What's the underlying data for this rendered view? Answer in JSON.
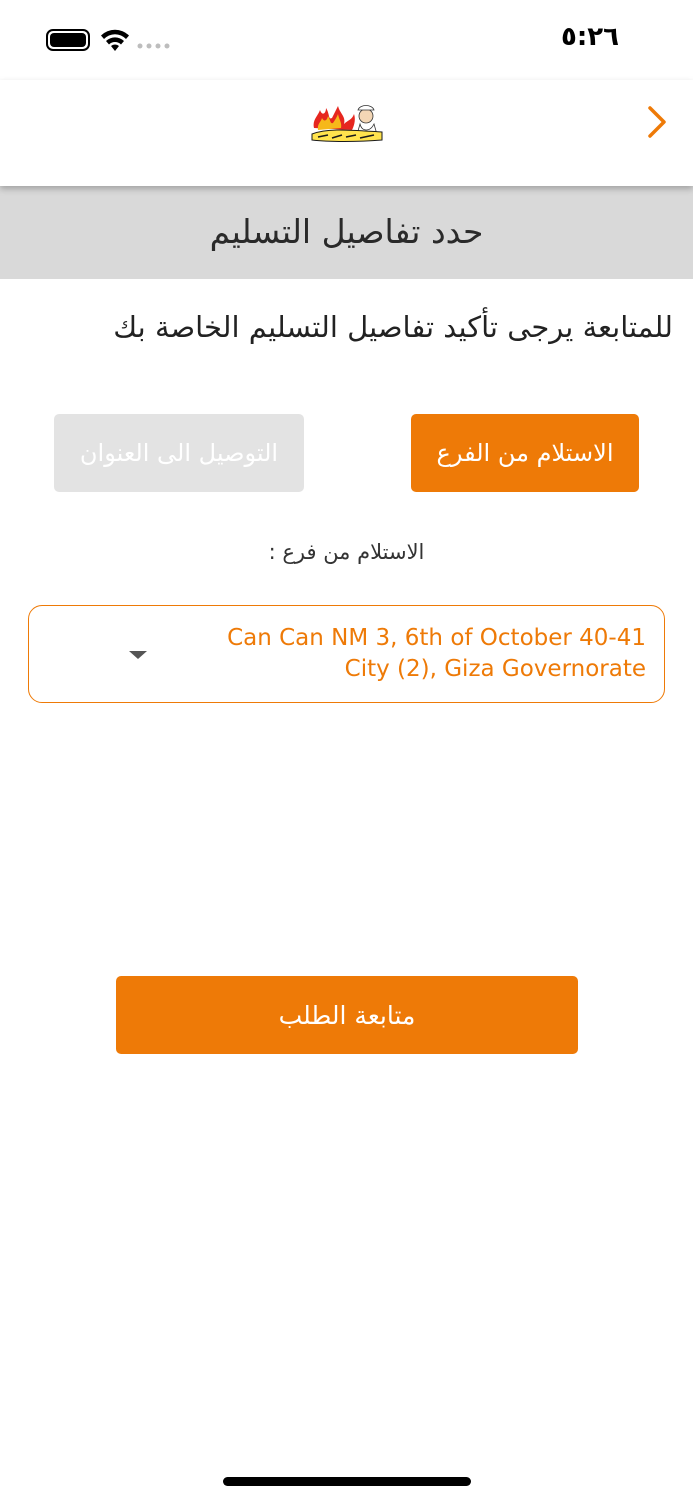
{
  "status_bar": {
    "time": "٥:٢٦",
    "icons": [
      "battery-icon",
      "wifi-icon",
      "signal-icon"
    ]
  },
  "nav": {
    "back_icon": "chevron-right-icon",
    "logo_icon": "restaurant-logo-icon"
  },
  "header": {
    "title": "حدد تفاصيل التسليم"
  },
  "instructions": "للمتابعة يرجى تأكيد تفاصيل التسليم الخاصة بك",
  "delivery_options": {
    "pickup_label": "الاستلام من الفرع",
    "delivery_label": "التوصيل الى العنوان",
    "selected": "pickup"
  },
  "branch": {
    "label": "الاستلام من فرع :",
    "selected_value": "Can Can NM 3, 6th of October 40-41 City (2), Giza Governorate",
    "dropdown_icon": "caret-down-icon"
  },
  "continue_button": {
    "label": "متابعة الطلب"
  },
  "colors": {
    "accent": "#ee7a07",
    "header_bg": "#d9d9d9",
    "disabled_bg": "#e3e3e3"
  }
}
